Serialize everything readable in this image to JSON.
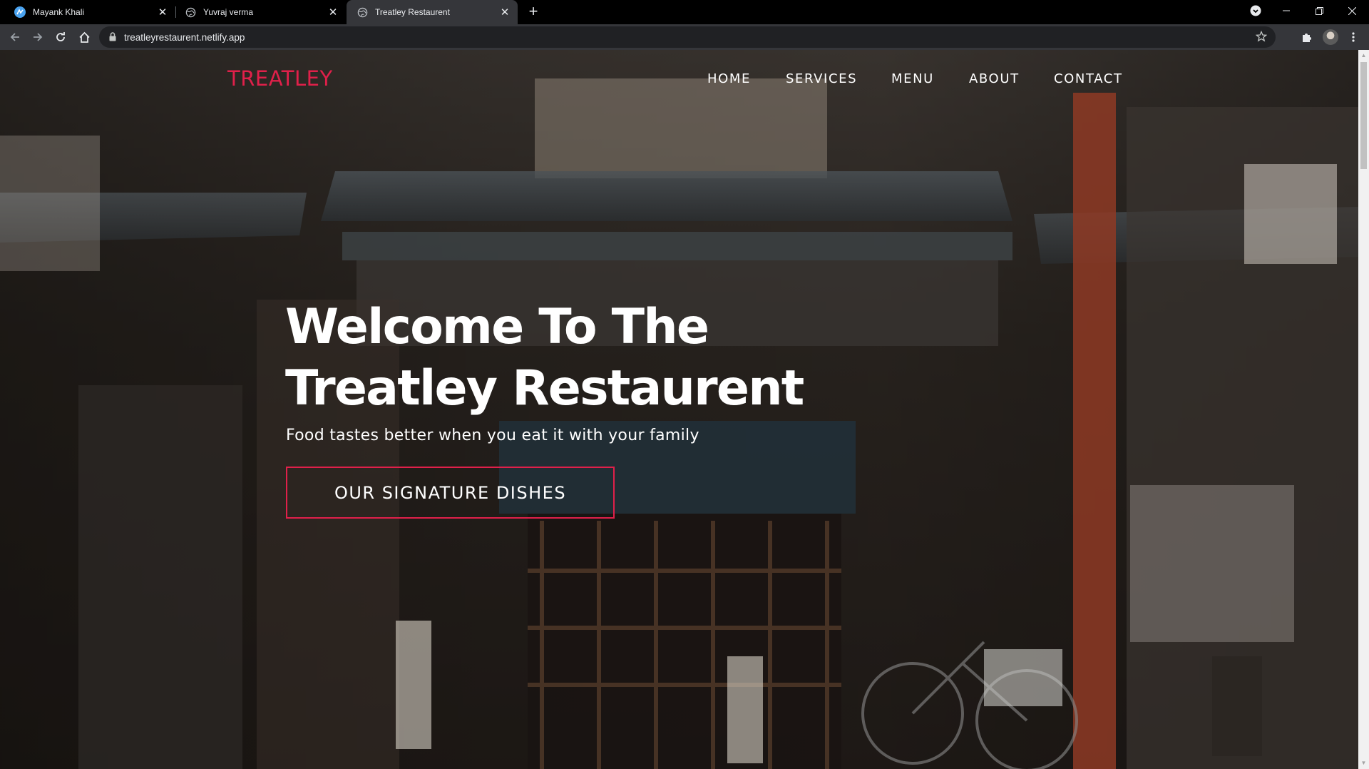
{
  "browser": {
    "tabs": [
      {
        "title": "Mayank Khali",
        "icon": "app-logo-icon"
      },
      {
        "title": "Yuvraj verma",
        "icon": "globe-icon"
      },
      {
        "title": "Treatley Restaurent",
        "icon": "globe-icon",
        "active": true
      }
    ],
    "url": "treatleyrestaurent.netlify.app"
  },
  "site": {
    "brand": "TREATLEY",
    "brand_color": "#e0204a",
    "nav": [
      "HOME",
      "SERVICES",
      "MENU",
      "ABOUT",
      "CONTACT"
    ],
    "hero": {
      "title_line1": "Welcome To The",
      "title_line2": "Treatley Restaurent",
      "subtitle": "Food tastes better when you eat it with your family",
      "cta_label": "OUR SIGNATURE DISHES"
    }
  }
}
